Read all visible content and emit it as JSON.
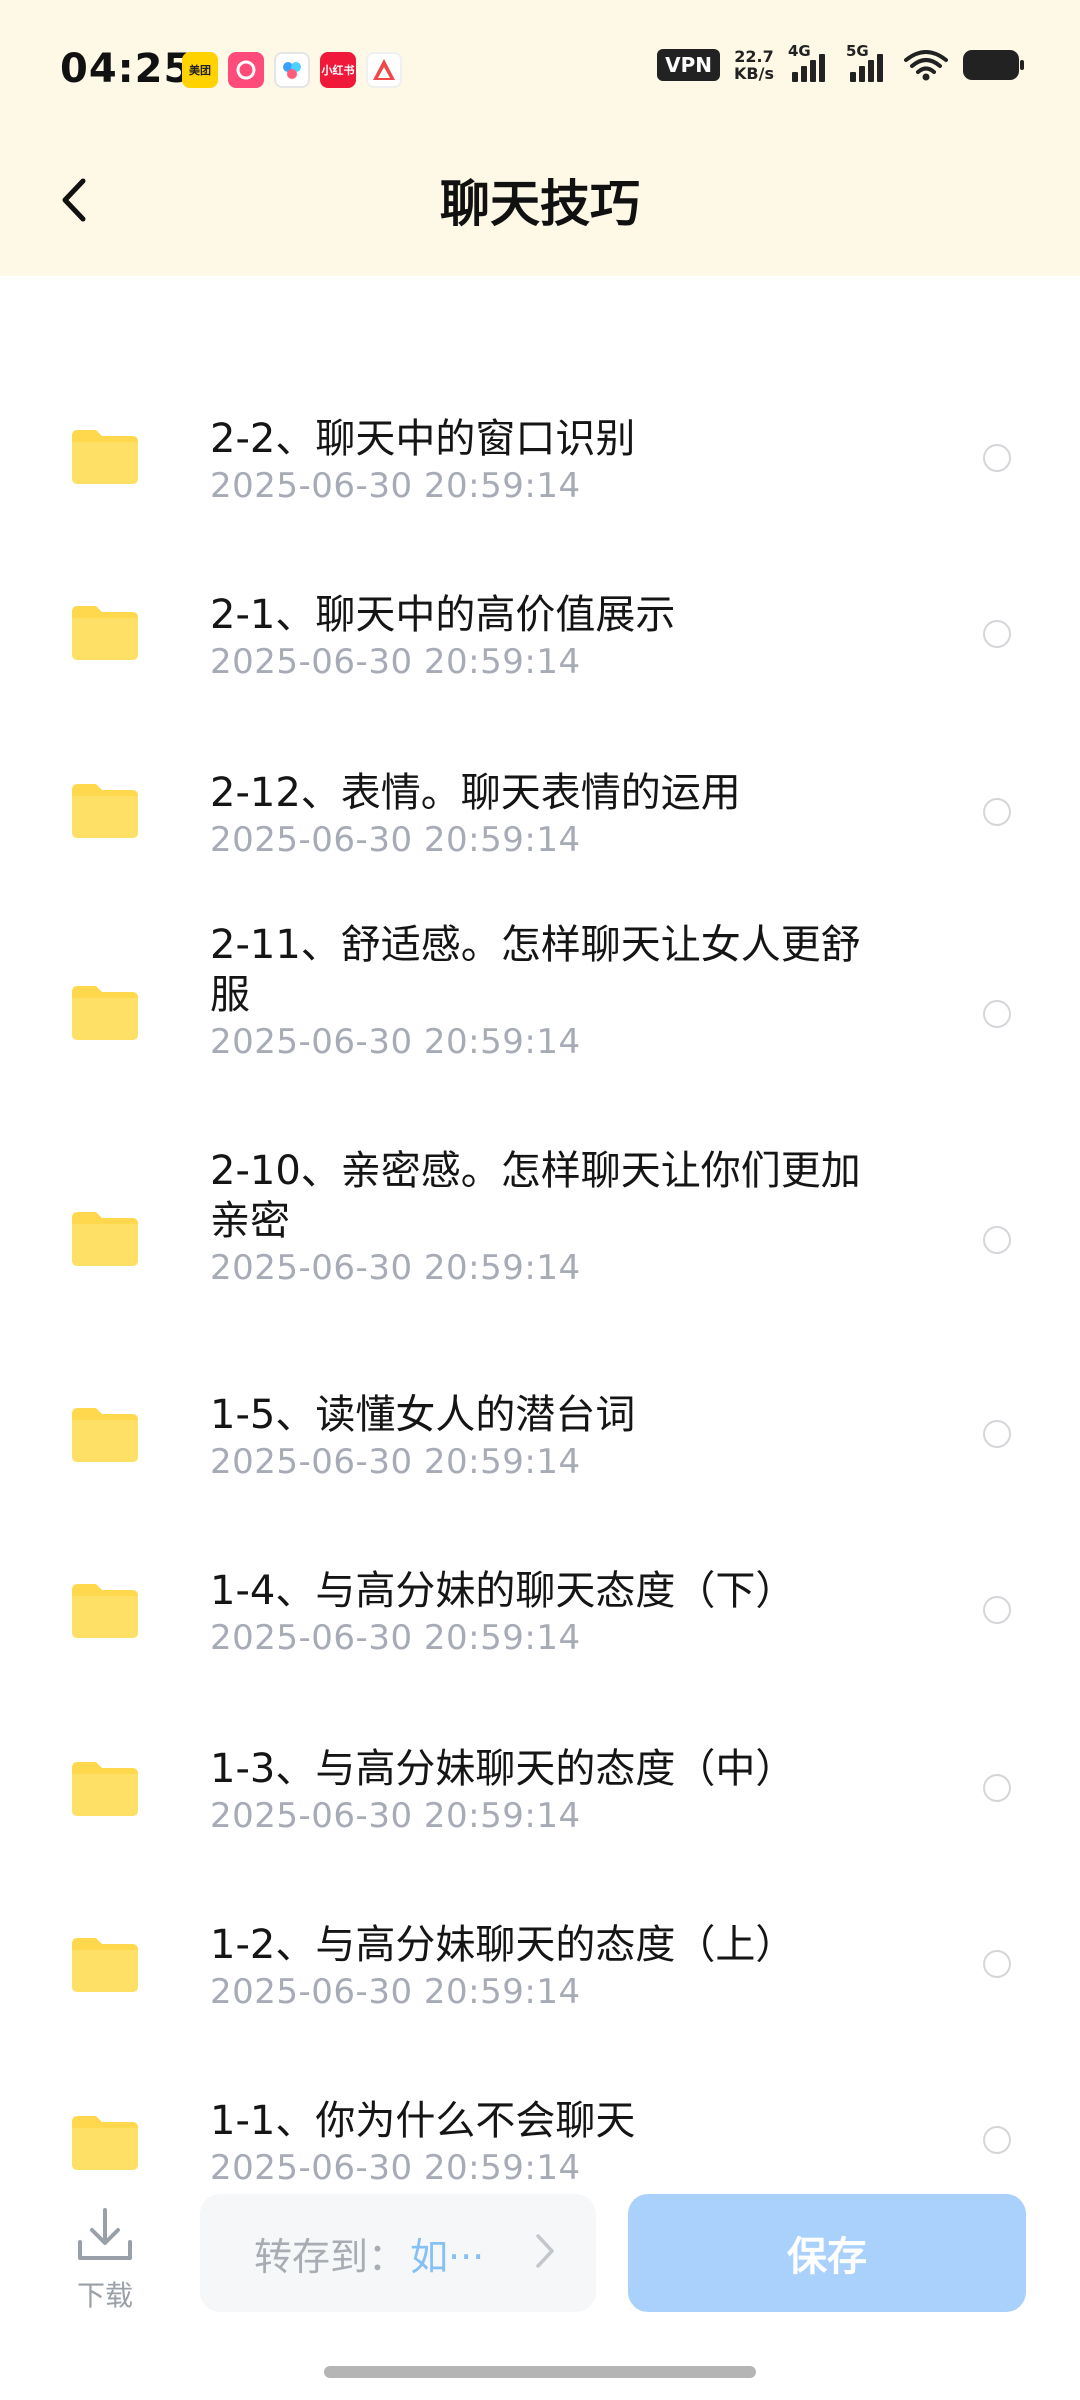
{
  "status_bar": {
    "time": "04:25",
    "app_icons": [
      "美团",
      "",
      "",
      "小红书",
      ""
    ],
    "vpn": "VPN",
    "speed_value": "22.7",
    "speed_unit": "KB/s",
    "network_1": "4G",
    "network_2": "5G",
    "battery": "battery-icon"
  },
  "header": {
    "title": "聊天技巧",
    "back_icon": "chevron-left-icon"
  },
  "files": [
    {
      "name": "2-2、聊天中的窗口识别",
      "date": "2025-06-30  20:59:14"
    },
    {
      "name": "2-1、聊天中的高价值展示",
      "date": "2025-06-30  20:59:14"
    },
    {
      "name": "2-12、表情。聊天表情的运用",
      "date": "2025-06-30  20:59:14"
    },
    {
      "name": "2-11、舒适感。怎样聊天让女人更舒服",
      "date": "2025-06-30  20:59:14"
    },
    {
      "name": "2-10、亲密感。怎样聊天让你们更加亲密",
      "date": "2025-06-30  20:59:14"
    },
    {
      "name": "1-5、读懂女人的潜台词",
      "date": "2025-06-30  20:59:14"
    },
    {
      "name": "1-4、与高分妹的聊天态度（下）",
      "date": "2025-06-30  20:59:14"
    },
    {
      "name": "1-3、与高分妹聊天的态度（中）",
      "date": "2025-06-30  20:59:14"
    },
    {
      "name": "1-2、与高分妹聊天的态度（上）",
      "date": "2025-06-30  20:59:14"
    },
    {
      "name": "1-1、你为什么不会聊天",
      "date": "2025-06-30  20:59:14"
    }
  ],
  "bottom_bar": {
    "download_label": "下载",
    "save_to_label": "转存到：",
    "save_to_dest": "如···",
    "save_button": "保存"
  },
  "colors": {
    "header_bg": "#fdf9e6",
    "folder": "#ffd84d",
    "save_button": "#a9d1fb",
    "date_text": "#a6abb5"
  }
}
